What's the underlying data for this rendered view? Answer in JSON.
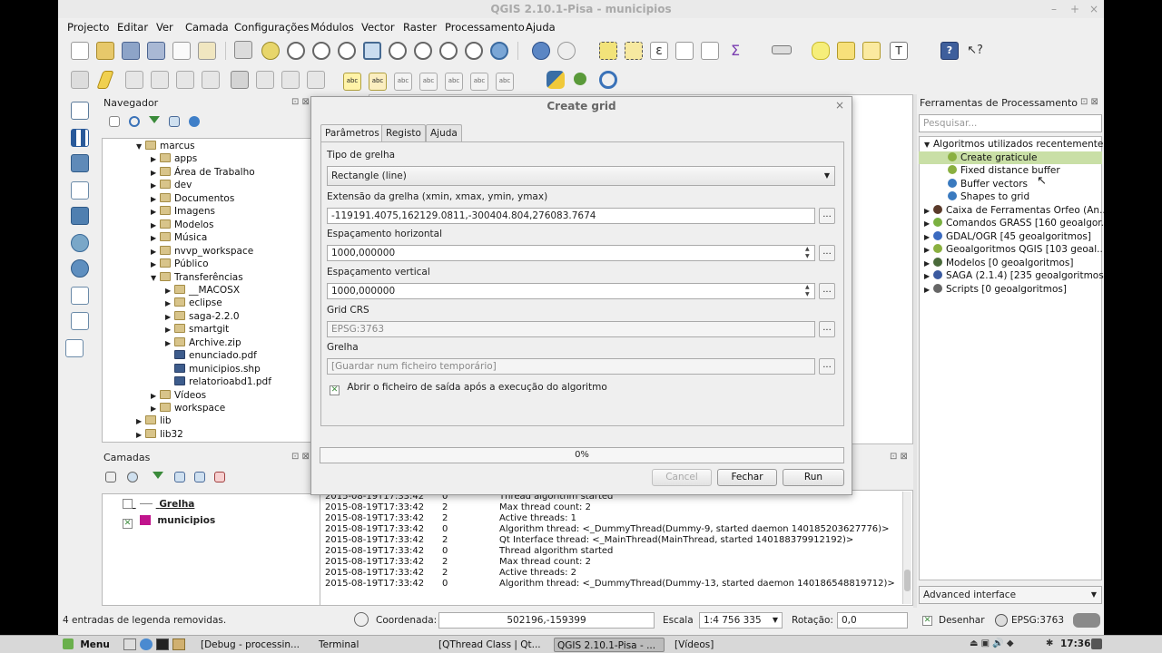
{
  "window": {
    "title": "QGIS 2.10.1-Pisa - municipios",
    "controls": [
      "–",
      "+",
      "×"
    ]
  },
  "menu": [
    "Projecto",
    "Editar",
    "Ver",
    "Camada",
    "Configurações",
    "Módulos",
    "Vector",
    "Raster",
    "Processamento",
    "Ajuda"
  ],
  "navigator": {
    "title": "Navegador",
    "items": [
      {
        "label": "marcus",
        "depth": 2,
        "arrow": "▼"
      },
      {
        "label": "apps",
        "depth": 3,
        "arrow": "▶"
      },
      {
        "label": "Área de Trabalho",
        "depth": 3,
        "arrow": "▶"
      },
      {
        "label": "dev",
        "depth": 3,
        "arrow": "▶"
      },
      {
        "label": "Documentos",
        "depth": 3,
        "arrow": "▶"
      },
      {
        "label": "Imagens",
        "depth": 3,
        "arrow": "▶"
      },
      {
        "label": "Modelos",
        "depth": 3,
        "arrow": "▶"
      },
      {
        "label": "Música",
        "depth": 3,
        "arrow": "▶"
      },
      {
        "label": "nvvp_workspace",
        "depth": 3,
        "arrow": "▶"
      },
      {
        "label": "Público",
        "depth": 3,
        "arrow": "▶"
      },
      {
        "label": "Transferências",
        "depth": 3,
        "arrow": "▼"
      },
      {
        "label": "__MACOSX",
        "depth": 4,
        "arrow": "▶"
      },
      {
        "label": "eclipse",
        "depth": 4,
        "arrow": "▶"
      },
      {
        "label": "saga-2.2.0",
        "depth": 4,
        "arrow": "▶"
      },
      {
        "label": "smartgit",
        "depth": 4,
        "arrow": "▶"
      },
      {
        "label": "Archive.zip",
        "depth": 4,
        "arrow": "▶"
      },
      {
        "label": "enunciado.pdf",
        "depth": 4,
        "arrow": ""
      },
      {
        "label": "municipios.shp",
        "depth": 4,
        "arrow": ""
      },
      {
        "label": "relatorioabd1.pdf",
        "depth": 4,
        "arrow": ""
      },
      {
        "label": "Vídeos",
        "depth": 3,
        "arrow": "▶"
      },
      {
        "label": "workspace",
        "depth": 3,
        "arrow": "▶"
      },
      {
        "label": "lib",
        "depth": 2,
        "arrow": "▶"
      },
      {
        "label": "lib32",
        "depth": 2,
        "arrow": "▶"
      }
    ]
  },
  "layers": {
    "title": "Camadas",
    "items": [
      {
        "label": "Grelha",
        "checked": false,
        "color": "#888888"
      },
      {
        "label": "municipios",
        "checked": true,
        "color": "#c0148c"
      }
    ]
  },
  "dialog": {
    "title": "Create grid",
    "tabs": [
      "Parâmetros",
      "Registo",
      "Ajuda"
    ],
    "grid_type_label": "Tipo de grelha",
    "grid_type_value": "Rectangle (line)",
    "extent_label": "Extensão da grelha (xmin, xmax, ymin, ymax)",
    "extent_value": "-119191.4075,162129.0811,-300404.804,276083.7674",
    "hspacing_label": "Espaçamento horizontal",
    "hspacing_value": "1000,000000",
    "vspacing_label": "Espaçamento vertical",
    "vspacing_value": "1000,000000",
    "crs_label": "Grid CRS",
    "crs_value": "EPSG:3763",
    "output_label": "Grelha",
    "output_placeholder": "[Guardar num ficheiro temporário]",
    "open_output_label": "Abrir o ficheiro de saída após a execução do algoritmo",
    "open_output_checked": true,
    "dots": "...",
    "progress": 0,
    "progress_label": "0%",
    "cancel": "Cancel",
    "close": "Fechar",
    "run": "Run"
  },
  "log": [
    {
      "time": "2015-08-19T17:33:42",
      "level": "0",
      "msg": "Thread algorithm started"
    },
    {
      "time": "2015-08-19T17:33:42",
      "level": "2",
      "msg": "Max thread count: 2"
    },
    {
      "time": "2015-08-19T17:33:42",
      "level": "2",
      "msg": "Active threads: 1"
    },
    {
      "time": "2015-08-19T17:33:42",
      "level": "0",
      "msg": "Algorithm thread: <_DummyThread(Dummy-9, started daemon 140185203627776)>"
    },
    {
      "time": "2015-08-19T17:33:42",
      "level": "2",
      "msg": "Qt Interface thread: <_MainThread(MainThread, started 140188379912192)>"
    },
    {
      "time": "2015-08-19T17:33:42",
      "level": "0",
      "msg": "Thread algorithm started"
    },
    {
      "time": "2015-08-19T17:33:42",
      "level": "2",
      "msg": "Max thread count: 2"
    },
    {
      "time": "2015-08-19T17:33:42",
      "level": "2",
      "msg": "Active threads: 2"
    },
    {
      "time": "2015-08-19T17:33:42",
      "level": "0",
      "msg": "Algorithm thread: <_DummyThread(Dummy-13, started daemon 140186548819712)>"
    }
  ],
  "processing": {
    "title": "Ferramentas de Processamento",
    "search_placeholder": "Pesquisar...",
    "groups": [
      {
        "label": "Algoritmos utilizados recentemente",
        "arrow": "▼",
        "depth": 0
      },
      {
        "label": "Create graticule",
        "arrow": "",
        "depth": 1,
        "selected": true
      },
      {
        "label": "Fixed distance buffer",
        "arrow": "",
        "depth": 1
      },
      {
        "label": "Buffer vectors",
        "arrow": "",
        "depth": 1
      },
      {
        "label": "Shapes to grid",
        "arrow": "",
        "depth": 1
      },
      {
        "label": "Caixa de Ferramentas Orfeo (An...",
        "arrow": "▶",
        "depth": 0
      },
      {
        "label": "Comandos GRASS [160 geoalgor...",
        "arrow": "▶",
        "depth": 0
      },
      {
        "label": "GDAL/OGR [45 geoalgoritmos]",
        "arrow": "▶",
        "depth": 0
      },
      {
        "label": "Geoalgoritmos QGIS [103 geoal...",
        "arrow": "▶",
        "depth": 0
      },
      {
        "label": "Modelos [0 geoalgoritmos]",
        "arrow": "▶",
        "depth": 0
      },
      {
        "label": "SAGA (2.1.4) [235 geoalgoritmos]",
        "arrow": "▶",
        "depth": 0
      },
      {
        "label": "Scripts [0 geoalgoritmos]",
        "arrow": "▶",
        "depth": 0
      }
    ],
    "mode": "Advanced interface"
  },
  "status": {
    "message": "4 entradas de legenda removidas.",
    "coord_label": "Coordenada:",
    "coord_value": "502196,-159399",
    "scale_label": "Escala",
    "scale_value": "1:4 756 335",
    "rotation_label": "Rotação:",
    "rotation_value": "0,0",
    "render_label": "Desenhar",
    "crs": "EPSG:3763"
  },
  "taskbar": {
    "menu": "Menu",
    "tasks": [
      "[Debug - processin...",
      "Terminal",
      "[QThread Class | Qt...",
      "QGIS 2.10.1-Pisa - ...",
      "[Vídeos]"
    ],
    "time": "17:36"
  },
  "colors": {
    "accent": "#7ab04c",
    "selected_row": "#c9dfa6",
    "layer_municipios": "#c0148c"
  }
}
